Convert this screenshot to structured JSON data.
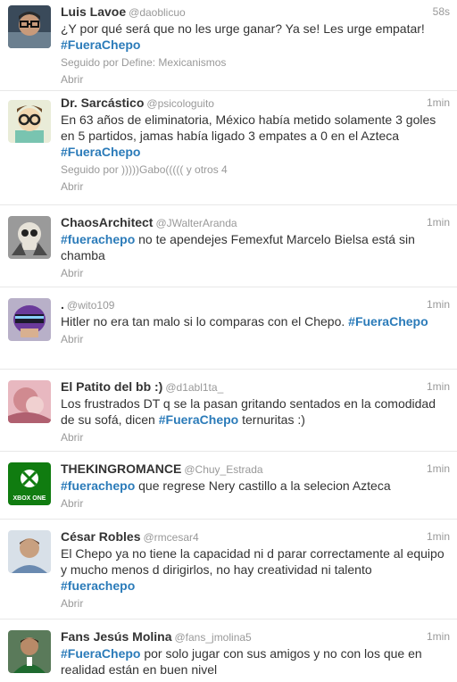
{
  "tweets": [
    {
      "avatar_icon": "avatar-man-glasses-icon",
      "name": "Luis Lavoe",
      "handle": "@daoblicuo",
      "time": "58s",
      "text_parts": [
        {
          "t": "¿Y por qué será que no les urge ganar? Ya se! Les urge empatar! ",
          "hashtag": false
        },
        {
          "t": "#FueraChepo",
          "hashtag": true
        }
      ],
      "meta": "Seguido por Define: Mexicanismos",
      "action": "Abrir"
    },
    {
      "avatar_icon": "avatar-cartoon-glasses-icon",
      "name": "Dr. Sarcástico",
      "handle": "@psicologuito",
      "time": "1min",
      "text_parts": [
        {
          "t": "En 63 años de eliminatoria, México había metido solamente 3 goles en 5 partidos, jamas había ligado 3 empates a 0 en el Azteca ",
          "hashtag": false
        },
        {
          "t": "#FueraChepo",
          "hashtag": true
        }
      ],
      "meta": "Seguido por )))))Gabo((((( y otros 4",
      "action": "Abrir"
    },
    {
      "avatar_icon": "avatar-skull-icon",
      "name": "ChaosArchitect",
      "handle": "@JWalterAranda",
      "time": "1min",
      "text_parts": [
        {
          "t": "#fuerachepo",
          "hashtag": true
        },
        {
          "t": " no te apendejes Femexfut Marcelo Bielsa está sin chamba",
          "hashtag": false
        }
      ],
      "meta": "",
      "action": "Abrir"
    },
    {
      "avatar_icon": "avatar-helmet-icon",
      "name": ".",
      "handle": "@wito109",
      "time": "1min",
      "text_parts": [
        {
          "t": "Hitler no era tan malo si lo comparas con el Chepo. ",
          "hashtag": false
        },
        {
          "t": "#FueraChepo",
          "hashtag": true
        }
      ],
      "meta": "",
      "action": "Abrir"
    },
    {
      "avatar_icon": "avatar-pink-photo-icon",
      "name": "El Patito del bb :)",
      "handle": "@d1abl1ta_",
      "time": "1min",
      "text_parts": [
        {
          "t": "Los frustrados DT q se la pasan gritando sentados en la comodidad de su sofá, dicen ",
          "hashtag": false
        },
        {
          "t": "#FueraChepo",
          "hashtag": true
        },
        {
          "t": " ternuritas :)",
          "hashtag": false
        }
      ],
      "meta": "",
      "action": "Abrir"
    },
    {
      "avatar_icon": "xbox-one-logo-icon",
      "avatar_logo_text": "XBOX ONE",
      "name": "THEKINGROMANCE",
      "handle": "@Chuy_Estrada",
      "time": "1min",
      "text_parts": [
        {
          "t": "#fuerachepo",
          "hashtag": true
        },
        {
          "t": " que regrese Nery castillo a la selecion Azteca",
          "hashtag": false
        }
      ],
      "meta": "",
      "action": "Abrir"
    },
    {
      "avatar_icon": "avatar-man-shirt-icon",
      "name": "César Robles",
      "handle": "@rmcesar4",
      "time": "1min",
      "text_parts": [
        {
          "t": "El Chepo ya no tiene la capacidad ni d parar correctamente al equipo y mucho menos d dirigirlos, no hay creatividad ni talento ",
          "hashtag": false
        },
        {
          "t": "#fuerachepo",
          "hashtag": true
        }
      ],
      "meta": "",
      "action": "Abrir"
    },
    {
      "avatar_icon": "avatar-soccer-player-icon",
      "name": "Fans Jesús Molina",
      "handle": "@fans_jmolina5",
      "time": "1min",
      "text_parts": [
        {
          "t": "#FueraChepo",
          "hashtag": true
        },
        {
          "t": " por solo jugar con sus amigos y no con los que en realidad están en buen nivel",
          "hashtag": false
        }
      ],
      "meta": "",
      "action": ""
    }
  ],
  "colors": {
    "hashtag": "#2b7bb9",
    "muted": "#999999",
    "text": "#333333",
    "xbox_green": "#107c10"
  }
}
